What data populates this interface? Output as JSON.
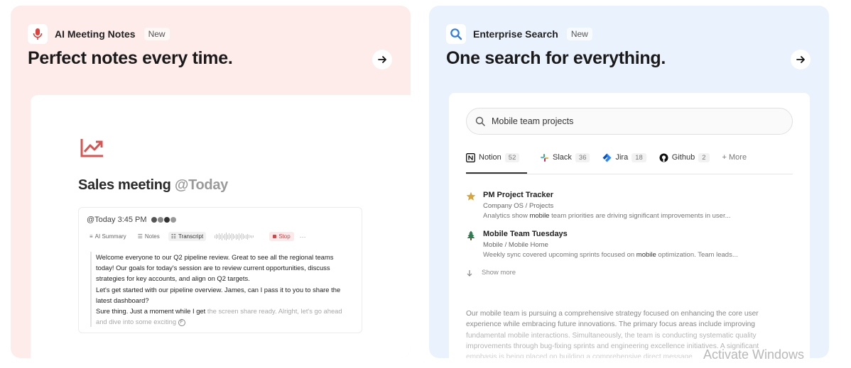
{
  "left_card": {
    "product": "AI Meeting Notes",
    "badge": "New",
    "headline": "Perfect notes every time.",
    "meeting": {
      "title": "Sales meeting",
      "date_mention": "@Today",
      "timestamp": "@Today 3:45 PM",
      "tabs": [
        "AI Summary",
        "Notes",
        "Transcript"
      ],
      "stop_label": "Stop",
      "transcript_lines": [
        "Welcome everyone to our Q2 pipeline review. Great to see all the regional teams",
        "today! Our goals for today's session are to review current opportunities, discuss",
        "strategies for key accounts, and align on Q2 targets.",
        "Let's get started with our pipeline overview. James, can I pass it to you to share the",
        "latest dashboard?"
      ],
      "transcript_last_bold": "Sure thing. Just a moment while I get",
      "transcript_last_faded": " the screen share ready. Alright, let's go ahead",
      "transcript_tail": "and dive into some exciting"
    }
  },
  "right_card": {
    "product": "Enterprise Search",
    "badge": "New",
    "headline": "One search for everything.",
    "search_query": "Mobile team projects",
    "sources": [
      {
        "name": "Notion",
        "count": "52"
      },
      {
        "name": "Slack",
        "count": "36"
      },
      {
        "name": "Jira",
        "count": "18"
      },
      {
        "name": "Github",
        "count": "2"
      }
    ],
    "more_label": "+ More",
    "results": [
      {
        "title": "PM Project Tracker",
        "path": "Company OS / Projects",
        "desc_before": "Analytics show ",
        "desc_highlight": "mobile",
        "desc_after": " team priorities are driving significant improvements in user..."
      },
      {
        "title": "Mobile Team Tuesdays",
        "path": "Mobile / Mobile Home",
        "desc_before": "Weekly sync covered upcoming sprints focused on ",
        "desc_highlight": "mobile",
        "desc_after": " optimization. Team leads..."
      }
    ],
    "show_more": "Show more",
    "summary_lines": [
      "Our mobile team is pursuing a comprehensive strategy focused on enhancing the core user",
      "experience while embracing future innovations. The primary focus areas include improving",
      "fundamental mobile interactions. Simultaneously, the team is conducting systematic quality",
      "improvements through bug-fixing sprints and engineering excellence initiatives. A significant",
      "emphasis is being placed on building a comprehensive direct message"
    ]
  },
  "watermark": "Activate Windows",
  "colors": {
    "left_bg": "#fdece9",
    "right_bg": "#eaf3fd",
    "accent_red": "#d64545",
    "accent_blue": "#2f7be6"
  }
}
